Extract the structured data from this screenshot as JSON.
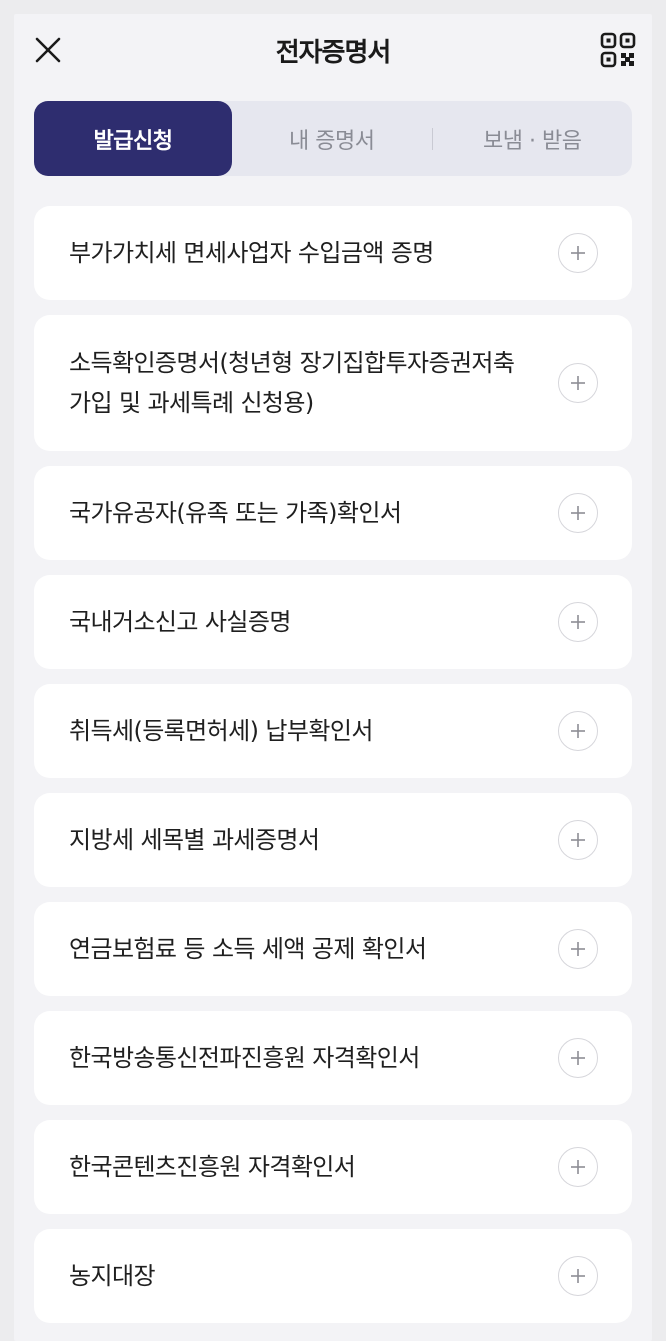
{
  "header": {
    "title": "전자증명서",
    "close_icon": "close-icon",
    "qr_icon": "qr-code-icon"
  },
  "tabs": [
    {
      "label": "발급신청",
      "active": true
    },
    {
      "label": "내 증명서",
      "active": false
    },
    {
      "label": "보냄 · 받음",
      "active": false
    }
  ],
  "colors": {
    "accent": "#2e2d6f",
    "background": "#f3f3f6",
    "card": "#ffffff"
  },
  "items": [
    {
      "label": "부가가치세 면세사업자 수입금액 증명"
    },
    {
      "label": "소득확인증명서(청년형 장기집합투자증권저축 가입 및 과세특례 신청용)"
    },
    {
      "label": "국가유공자(유족 또는 가족)확인서"
    },
    {
      "label": "국내거소신고 사실증명"
    },
    {
      "label": "취득세(등록면허세) 납부확인서"
    },
    {
      "label": "지방세 세목별 과세증명서"
    },
    {
      "label": "연금보험료 등 소득 세액 공제 확인서"
    },
    {
      "label": "한국방송통신전파진흥원 자격확인서"
    },
    {
      "label": "한국콘텐츠진흥원 자격확인서"
    },
    {
      "label": "농지대장"
    }
  ]
}
